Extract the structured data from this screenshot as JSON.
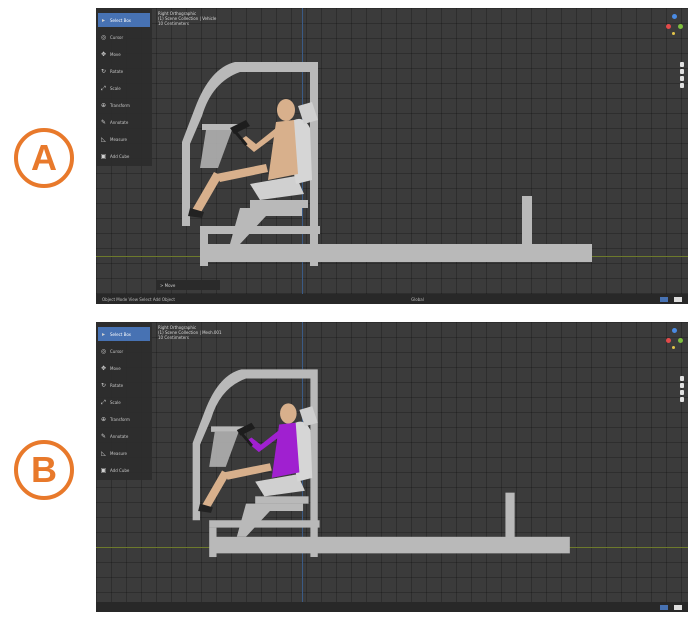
{
  "markers": {
    "a": "A",
    "b": "B"
  },
  "panels": [
    {
      "id": "a",
      "view_info": {
        "line1": "Right Orthographic",
        "line2": "(1) Scene Collection | Vehicle",
        "line3": "10 Centimeters"
      },
      "operator_panel": "> Move",
      "status_left": "Object Mode   View   Select   Add   Object",
      "status_mid": "Global",
      "occupant_shirt": false
    },
    {
      "id": "b",
      "view_info": {
        "line1": "Right Orthographic",
        "line2": "(1) Scene Collection | Mesh.001",
        "line3": "10 Centimeters"
      },
      "operator_panel": "",
      "status_left": "",
      "status_mid": "",
      "occupant_shirt": true
    }
  ],
  "tools": [
    {
      "label": "Select Box",
      "icon": "select-box-icon"
    },
    {
      "label": "Cursor",
      "icon": "cursor-icon"
    },
    {
      "label": "Move",
      "icon": "move-icon"
    },
    {
      "label": "Rotate",
      "icon": "rotate-icon"
    },
    {
      "label": "Scale",
      "icon": "scale-icon"
    },
    {
      "label": "Transform",
      "icon": "transform-icon"
    },
    {
      "label": "Annotate",
      "icon": "annotate-icon"
    },
    {
      "label": "Measure",
      "icon": "measure-icon"
    },
    {
      "label": "Add Cube",
      "icon": "add-cube-icon"
    }
  ],
  "colors": {
    "marker": "#e8792b",
    "viewport": "#3b3b3b",
    "frame": "#b9b9b9",
    "skin": "#d8b08c",
    "shirt": "#a020d0",
    "active_tool": "#4772b3"
  }
}
